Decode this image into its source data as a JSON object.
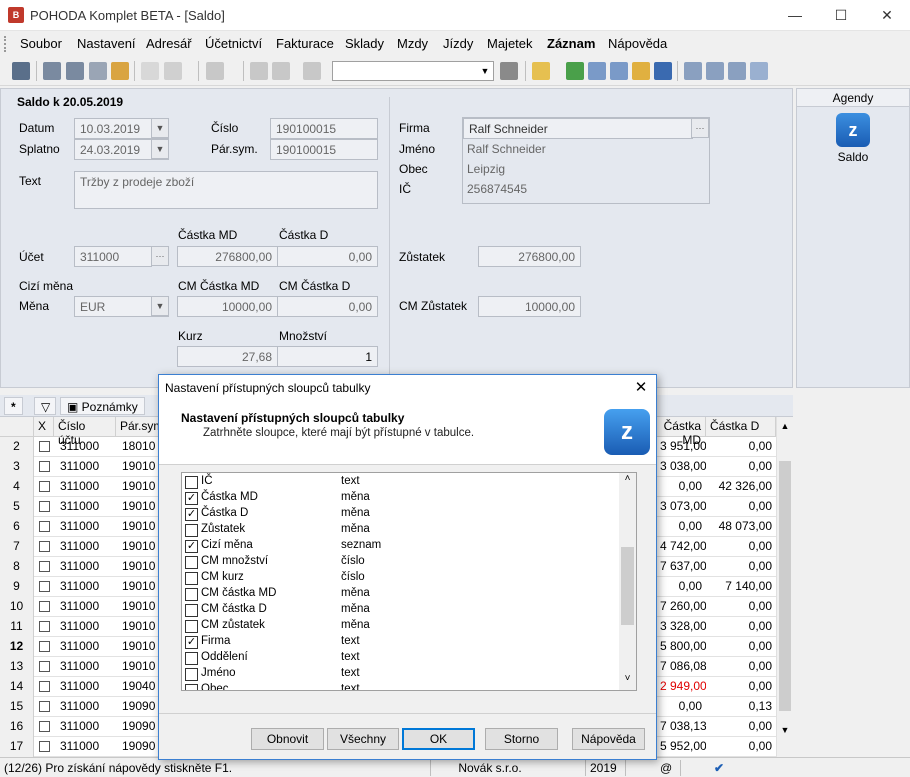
{
  "window": {
    "title": "POHODA Komplet BETA - [Saldo]",
    "icon_name": "pohoda-app-icon"
  },
  "menu": [
    "Soubor",
    "Nastavení",
    "Adresář",
    "Účetnictví",
    "Fakturace",
    "Sklady",
    "Mzdy",
    "Jízdy",
    "Majetek",
    "Záznam",
    "Nápověda"
  ],
  "form": {
    "title": "Saldo k 20.05.2019",
    "datum_label": "Datum",
    "datum": "10.03.2019",
    "splatno_label": "Splatno",
    "splatno": "24.03.2019",
    "cislo_label": "Číslo",
    "cislo": "190100015",
    "parsym_label": "Pár.sym.",
    "parsym": "190100015",
    "text_label": "Text",
    "text": "Tržby z prodeje zboží",
    "castka_md_label": "Částka MD",
    "castka_d_label": "Částka D",
    "ucet_label": "Účet",
    "ucet": "311000",
    "castka_md": "276800,00",
    "castka_d": "0,00",
    "cizi_mena_label": "Cizí měna",
    "cm_castka_md_label": "CM Částka MD",
    "cm_castka_d_label": "CM Částka D",
    "mena_label": "Měna",
    "mena": "EUR",
    "cm_castka_md": "10000,00",
    "cm_castka_d": "0,00",
    "kurz_label": "Kurz",
    "mnozstvi_label": "Množství",
    "kurz": "27,68",
    "mnozstvi": "1",
    "firma_label": "Firma",
    "firma": "Ralf Schneider",
    "jmeno_label": "Jméno",
    "jmeno": "Ralf Schneider",
    "obec_label": "Obec",
    "obec": "Leipzig",
    "ic_label": "IČ",
    "ic": "256874545",
    "zustatek_label": "Zůstatek",
    "zustatek": "276800,00",
    "cm_zustatek_label": "CM Zůstatek",
    "cm_zustatek": "10000,00"
  },
  "agenda": {
    "header": "Agendy",
    "item": "Saldo"
  },
  "tabs": {
    "star": "*",
    "poznamky": "Poznámky"
  },
  "grid": {
    "headers": {
      "x": "X",
      "ucet": "Číslo účtu",
      "parsym": "Pár.sym",
      "castka_md": "Částka MD",
      "castka_d": "Částka D"
    },
    "rows": [
      {
        "n": "2",
        "ucet": "311000",
        "parsym": "18010",
        "md": "3 951,00",
        "d": "0,00"
      },
      {
        "n": "3",
        "ucet": "311000",
        "parsym": "19010",
        "md": "3 038,00",
        "d": "0,00"
      },
      {
        "n": "4",
        "ucet": "311000",
        "parsym": "19010",
        "md": "0,00",
        "d": "42 326,00"
      },
      {
        "n": "5",
        "ucet": "311000",
        "parsym": "19010",
        "md": "3 073,00",
        "d": "0,00"
      },
      {
        "n": "6",
        "ucet": "311000",
        "parsym": "19010",
        "md": "0,00",
        "d": "48 073,00"
      },
      {
        "n": "7",
        "ucet": "311000",
        "parsym": "19010",
        "md": "4 742,00",
        "d": "0,00"
      },
      {
        "n": "8",
        "ucet": "311000",
        "parsym": "19010",
        "md": "7 637,00",
        "d": "0,00"
      },
      {
        "n": "9",
        "ucet": "311000",
        "parsym": "19010",
        "md": "0,00",
        "d": "7 140,00"
      },
      {
        "n": "10",
        "ucet": "311000",
        "parsym": "19010",
        "md": "7 260,00",
        "d": "0,00"
      },
      {
        "n": "11",
        "ucet": "311000",
        "parsym": "19010",
        "md": "3 328,00",
        "d": "0,00"
      },
      {
        "n": "12",
        "ucet": "311000",
        "parsym": "19010",
        "md": "5 800,00",
        "d": "0,00"
      },
      {
        "n": "13",
        "ucet": "311000",
        "parsym": "19010",
        "md": "7 086,08",
        "d": "0,00"
      },
      {
        "n": "14",
        "ucet": "311000",
        "parsym": "19040",
        "md": "2 949,00",
        "d": "0,00"
      },
      {
        "n": "15",
        "ucet": "311000",
        "parsym": "19090",
        "md": "0,00",
        "d": "0,13"
      },
      {
        "n": "16",
        "ucet": "311000",
        "parsym": "19090",
        "md": "7 038,13",
        "d": "0,00"
      },
      {
        "n": "17",
        "ucet": "311000",
        "parsym": "19090",
        "md": "5 952,00",
        "d": "0,00"
      }
    ],
    "negative_color": "#e00000"
  },
  "status": {
    "help": "(12/26) Pro získání nápovědy stiskněte F1.",
    "user": "Novák s.r.o.",
    "year": "2019",
    "at": "@"
  },
  "dialog": {
    "title": "Nastavení přístupných sloupců tabulky",
    "heading": "Nastavení přístupných sloupců tabulky",
    "subheading": "Zatrhněte sloupce, které mají být přístupné v tabulce.",
    "items": [
      {
        "name": "IČ",
        "type": "text",
        "checked": false
      },
      {
        "name": "Částka MD",
        "type": "měna",
        "checked": true
      },
      {
        "name": "Částka D",
        "type": "měna",
        "checked": true
      },
      {
        "name": "Zůstatek",
        "type": "měna",
        "checked": false
      },
      {
        "name": "Cizí měna",
        "type": "seznam",
        "checked": true
      },
      {
        "name": "CM množství",
        "type": "číslo",
        "checked": false
      },
      {
        "name": "CM kurz",
        "type": "číslo",
        "checked": false
      },
      {
        "name": "CM částka MD",
        "type": "měna",
        "checked": false
      },
      {
        "name": "CM částka D",
        "type": "měna",
        "checked": false
      },
      {
        "name": "CM zůstatek",
        "type": "měna",
        "checked": false
      },
      {
        "name": "Firma",
        "type": "text",
        "checked": true
      },
      {
        "name": "Oddělení",
        "type": "text",
        "checked": false
      },
      {
        "name": "Jméno",
        "type": "text",
        "checked": false
      },
      {
        "name": "Obec",
        "type": "text",
        "checked": false
      }
    ],
    "buttons": {
      "obnovit": "Obnovit",
      "vsechny": "Všechny",
      "ok": "OK",
      "storno": "Storno",
      "napoveda": "Nápověda"
    }
  }
}
